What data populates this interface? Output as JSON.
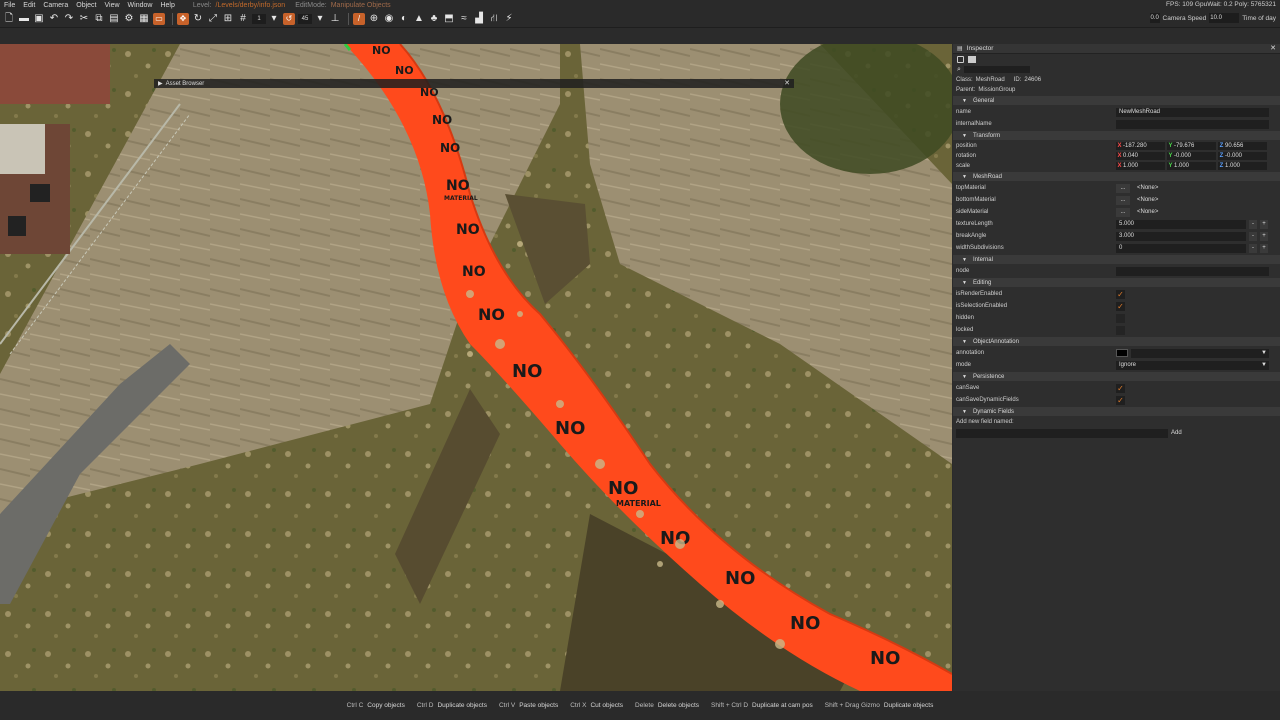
{
  "menubar": {
    "items": [
      "File",
      "Edit",
      "Camera",
      "Object",
      "View",
      "Window",
      "Help"
    ],
    "level_label": "Level:",
    "level_path": "/Levels/derby/info.json",
    "editmode_label": "EditMode:",
    "editmode_value": "Manipulate Objects",
    "stats": "FPS: 109  GpuWait: 0.2  Poly: 5765321"
  },
  "toolbar": {
    "snap_value": "1",
    "angle_value": "45",
    "speed_value": "0.0",
    "camera_speed_label": "Camera Speed",
    "time_value": "10.0",
    "time_label": "Time of day"
  },
  "viewport": {
    "asset_browser_label": "Asset Browser",
    "road_label_big": "NO",
    "road_label_small": "MATERIAL",
    "colors": {
      "road": "#ff4a1c",
      "grass": "#6f6a3c",
      "dirt": "#9b8e72"
    }
  },
  "inspector": {
    "tab_label": "Inspector",
    "class_label": "Class:",
    "class_value": "MeshRoad",
    "id_label": "ID:",
    "id_value": "24606",
    "parent_label": "Parent:",
    "parent_value": "MissionGroup",
    "sections": {
      "general": "General",
      "transform": "Transform",
      "meshroad": "MeshRoad",
      "internal": "Internal",
      "editing": "Editing",
      "annotation": "ObjectAnnotation",
      "persistence": "Persistence",
      "dynamic": "Dynamic Fields"
    },
    "general": {
      "name_key": "name",
      "name_value": "NewMeshRoad",
      "internal_key": "internalName"
    },
    "transform": {
      "position_key": "position",
      "position": [
        "-187.280",
        "-79.676",
        "90.656"
      ],
      "rotation_key": "rotation",
      "rotation": [
        "0.040",
        "-0.000",
        "-0.000"
      ],
      "scale_key": "scale",
      "scale": [
        "1.000",
        "1.000",
        "1.000"
      ]
    },
    "meshroad": {
      "top_key": "topMaterial",
      "top_value": "<None>",
      "bottom_key": "bottomMaterial",
      "bottom_value": "<None>",
      "side_key": "sideMaterial",
      "side_value": "<None>",
      "texlen_key": "textureLength",
      "texlen_value": "5.000",
      "break_key": "breakAngle",
      "break_value": "3.000",
      "width_key": "widthSubdivisions",
      "width_value": "0",
      "dots": "..."
    },
    "internal": {
      "node_key": "node"
    },
    "editing": {
      "render_key": "isRenderEnabled",
      "selection_key": "isSelectionEnabled",
      "hidden_key": "hidden",
      "locked_key": "locked"
    },
    "annotation": {
      "annotation_key": "annotation",
      "mode_key": "mode",
      "mode_value": "Ignore"
    },
    "persistence": {
      "cansave_key": "canSave",
      "candyn_key": "canSaveDynamicFields"
    },
    "dynamic": {
      "add_label": "Add new field named:",
      "add_button": "Add"
    }
  },
  "statusbar": [
    {
      "key": "Ctrl C",
      "desc": "Copy objects"
    },
    {
      "key": "Ctrl D",
      "desc": "Duplicate objects"
    },
    {
      "key": "Ctrl V",
      "desc": "Paste objects"
    },
    {
      "key": "Ctrl X",
      "desc": "Cut objects"
    },
    {
      "key": "Delete",
      "desc": "Delete objects"
    },
    {
      "key": "Shift + Ctrl D",
      "desc": "Duplicate at cam pos"
    },
    {
      "key": "Shift + Drag Gizmo",
      "desc": "Duplicate objects"
    }
  ]
}
